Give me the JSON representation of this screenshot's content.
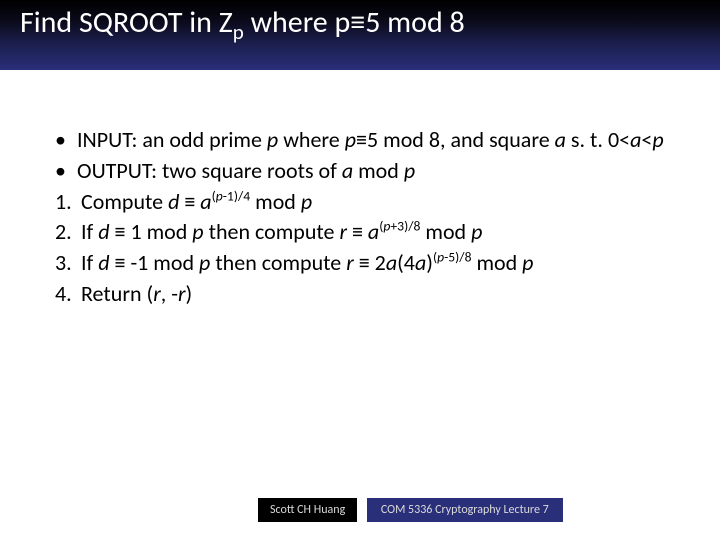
{
  "title_html": "Find SQROOT in Z<sub>p</sub> where p≡5 mod 8",
  "bullets": [
    {
      "marker": "•",
      "html": "INPUT: an odd prime <i>p</i> where <i>p</i>≡5 mod 8, and square <i>a</i> s. t. 0&lt;<i>a</i>&lt;<i>p</i>"
    },
    {
      "marker": "•",
      "html": "OUTPUT: two square roots of <i>a</i> mod <i>p</i>"
    }
  ],
  "steps": [
    {
      "marker": "1.",
      "html": "Compute <i>d</i> ≡ <i>a</i><sup>(<i>p</i>-1)/4</sup> mod <i>p</i>"
    },
    {
      "marker": "2.",
      "html": "If <i>d</i> ≡ 1 mod <i>p</i> then compute <i>r</i> ≡ <i>a</i><sup>(<i>p</i>+3)/8</sup> mod <i>p</i>"
    },
    {
      "marker": "3.",
      "html": "If <i>d</i> ≡ -1 mod <i>p</i> then compute <i>r</i> ≡ 2<i>a</i>(4<i>a</i>)<sup>(<i>p</i>-5)/8</sup> mod <i>p</i>"
    },
    {
      "marker": "4.",
      "html": "Return (<i>r</i>, -<i>r</i>)"
    }
  ],
  "footer": {
    "author": "Scott CH Huang",
    "course": "COM 5336 Cryptography Lecture 7"
  }
}
